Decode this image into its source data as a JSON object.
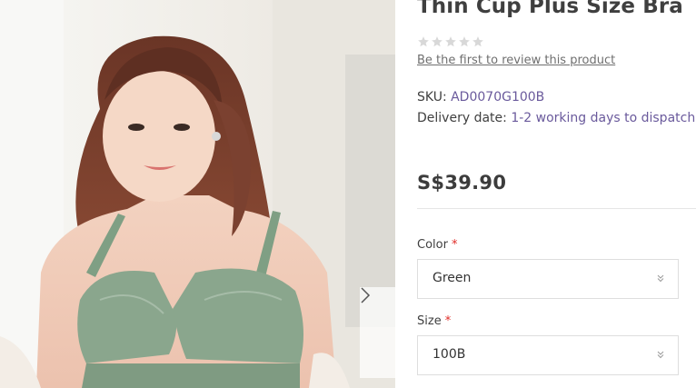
{
  "gallery": {
    "image_alt": "Model wearing green thin cup plus size bra",
    "next_icon": "chevron-right-icon"
  },
  "product": {
    "title": "Thin Cup Plus Size Bra",
    "rating_stars": 0,
    "rating_max": 5,
    "review_link": "Be the first to review this product",
    "sku_label": "SKU: ",
    "sku_value": "AD0070G100B",
    "delivery_label": "Delivery date: ",
    "delivery_value": "1-2 working days to dispatch",
    "price": "S$39.90"
  },
  "options": {
    "color": {
      "label": "Color",
      "required": "*",
      "selected": "Green"
    },
    "size": {
      "label": "Size",
      "required": "*",
      "selected": "100B"
    }
  },
  "colors": {
    "link_value": "#6a5a9c",
    "required": "#e02b27",
    "text": "#3f3f3f",
    "star_empty": "#d8d8d8"
  }
}
